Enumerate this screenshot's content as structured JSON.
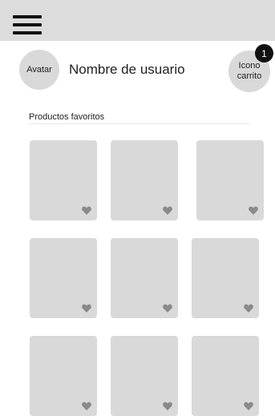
{
  "header": {
    "menu_icon": "hamburger-menu-icon"
  },
  "profile": {
    "avatar_label": "Avatar",
    "username": "Nombre de usuario",
    "cart_label": "Icono carrito",
    "cart_count": "1"
  },
  "favorites": {
    "section_title": "Productos favoritos",
    "products": [
      {
        "favorite_icon": "heart-icon"
      },
      {
        "favorite_icon": "heart-icon"
      },
      {
        "favorite_icon": "heart-icon"
      },
      {
        "favorite_icon": "heart-icon"
      },
      {
        "favorite_icon": "heart-icon"
      },
      {
        "favorite_icon": "heart-icon"
      },
      {
        "favorite_icon": "heart-icon"
      },
      {
        "favorite_icon": "heart-icon"
      },
      {
        "favorite_icon": "heart-icon"
      }
    ]
  },
  "colors": {
    "topbar": "#dcdcdc",
    "placeholder": "#d9d9d9",
    "heart": "#8a8a8a",
    "badge": "#111111"
  }
}
